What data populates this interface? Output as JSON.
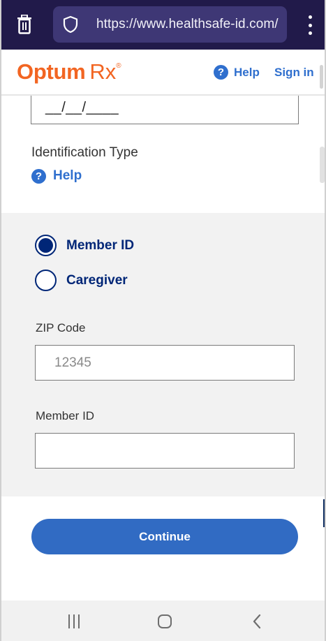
{
  "browser": {
    "url": "https://www.healthsafe-id.com/",
    "icons": {
      "trash": "trash-icon",
      "shield": "shield-icon",
      "menu": "kebab-menu-icon"
    }
  },
  "header": {
    "logo_brand": "Optum",
    "logo_product": "Rx",
    "logo_mark": "®",
    "help_label": "Help",
    "signin_label": "Sign in",
    "colors": {
      "brand": "#f26522",
      "link": "#2f6fce"
    }
  },
  "form": {
    "date_value": "__/__/____",
    "id_type_label": "Identification Type",
    "id_help_label": "Help",
    "radio_options": [
      {
        "label": "Member ID",
        "selected": true
      },
      {
        "label": "Caregiver",
        "selected": false
      }
    ],
    "zip_label": "ZIP Code",
    "zip_placeholder": "12345",
    "member_id_label": "Member ID",
    "member_id_value": "",
    "continue_label": "Continue",
    "colors": {
      "radio": "#002677",
      "button": "#316bc3",
      "panel": "#f2f2f2"
    }
  },
  "nav_bar": {
    "icons": [
      "recent-apps-icon",
      "home-icon",
      "back-icon"
    ]
  }
}
